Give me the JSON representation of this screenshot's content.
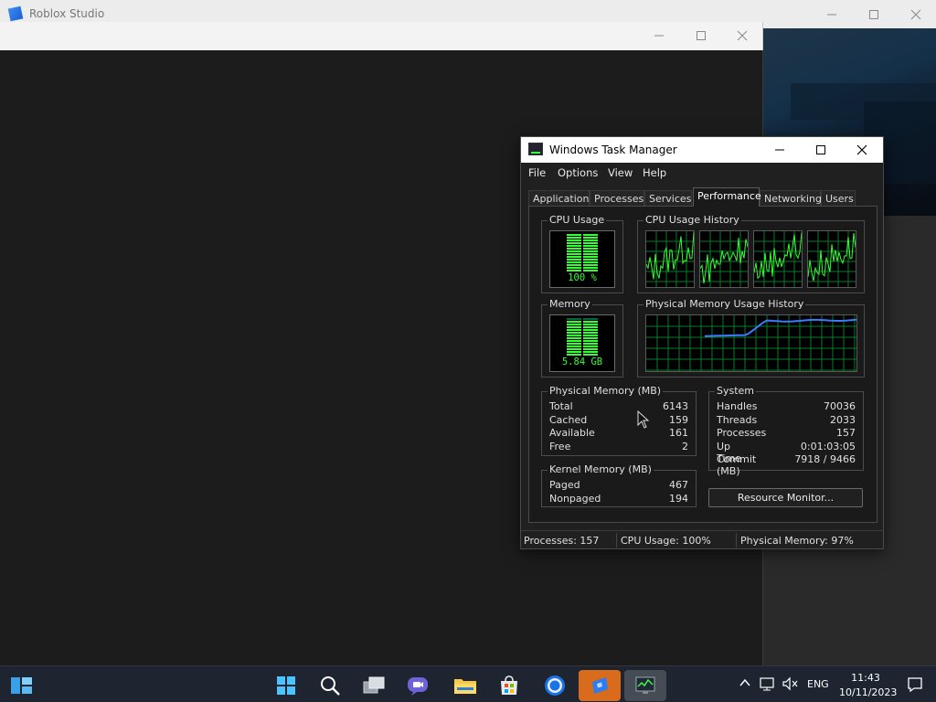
{
  "studio": {
    "title": "Roblox Studio"
  },
  "taskmanager": {
    "title": "Windows Task Manager",
    "menu": [
      "File",
      "Options",
      "View",
      "Help"
    ],
    "tabs": [
      "Applications",
      "Processes",
      "Services",
      "Performance",
      "Networking",
      "Users"
    ],
    "active_tab": "Performance",
    "cpu_usage_label": "CPU Usage",
    "cpu_usage_value": "100 %",
    "cpu_history_label": "CPU Usage History",
    "memory_label": "Memory",
    "memory_value": "5.84 GB",
    "memory_history_label": "Physical Memory Usage History",
    "physical_memory": {
      "label": "Physical Memory (MB)",
      "rows": [
        {
          "label": "Total",
          "value": "6143"
        },
        {
          "label": "Cached",
          "value": "159"
        },
        {
          "label": "Available",
          "value": "161"
        },
        {
          "label": "Free",
          "value": "2"
        }
      ]
    },
    "kernel_memory": {
      "label": "Kernel Memory (MB)",
      "rows": [
        {
          "label": "Paged",
          "value": "467"
        },
        {
          "label": "Nonpaged",
          "value": "194"
        }
      ]
    },
    "system": {
      "label": "System",
      "rows": [
        {
          "label": "Handles",
          "value": "70036"
        },
        {
          "label": "Threads",
          "value": "2033"
        },
        {
          "label": "Processes",
          "value": "157"
        },
        {
          "label": "Up Time",
          "value": "0:01:03:05"
        },
        {
          "label": "Commit (MB)",
          "value": "7918 / 9466"
        }
      ]
    },
    "resource_monitor_label": "Resource Monitor...",
    "status": {
      "processes": "Processes: 157",
      "cpu": "CPU Usage: 100%",
      "memory": "Physical Memory: 97%"
    }
  },
  "taskbar": {
    "language": "ENG",
    "time": "11:43",
    "date": "10/11/2023",
    "icons": [
      "start-icon",
      "search-icon",
      "task-view-icon",
      "teams-chat-icon",
      "file-explorer-icon",
      "microsoft-store-icon",
      "chrome-icon",
      "roblox-studio-icon",
      "task-manager-icon"
    ]
  },
  "colors": {
    "graph_green": "#33ff33",
    "grid_green": "#0a7a2a",
    "memory_line": "#3c7bff"
  }
}
